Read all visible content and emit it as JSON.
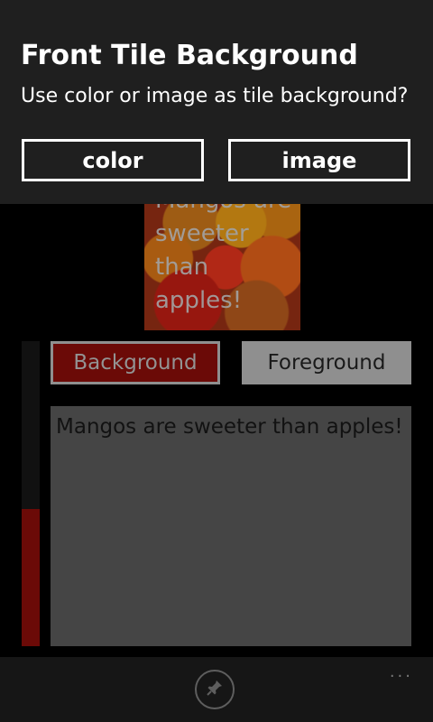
{
  "dialog": {
    "title": "Front Tile Background",
    "message": "Use color or image as tile background?",
    "color_label": "color",
    "image_label": "image"
  },
  "tile_preview": {
    "text": "Mangos are sweeter than apples!"
  },
  "buttons": {
    "background_label": "Background",
    "foreground_label": "Foreground"
  },
  "text_area": {
    "value": "Mangos are sweeter than apples!"
  },
  "slider": {
    "level": 0.45,
    "color": "#6b0a07"
  },
  "app_bar": {
    "pin_icon": "pin-icon",
    "more_icon": "more-icon",
    "more_text": "..."
  },
  "colors": {
    "accent": "#6b0a07",
    "dialog_bg": "#1f1f1f",
    "text_area_bg": "#454545"
  }
}
